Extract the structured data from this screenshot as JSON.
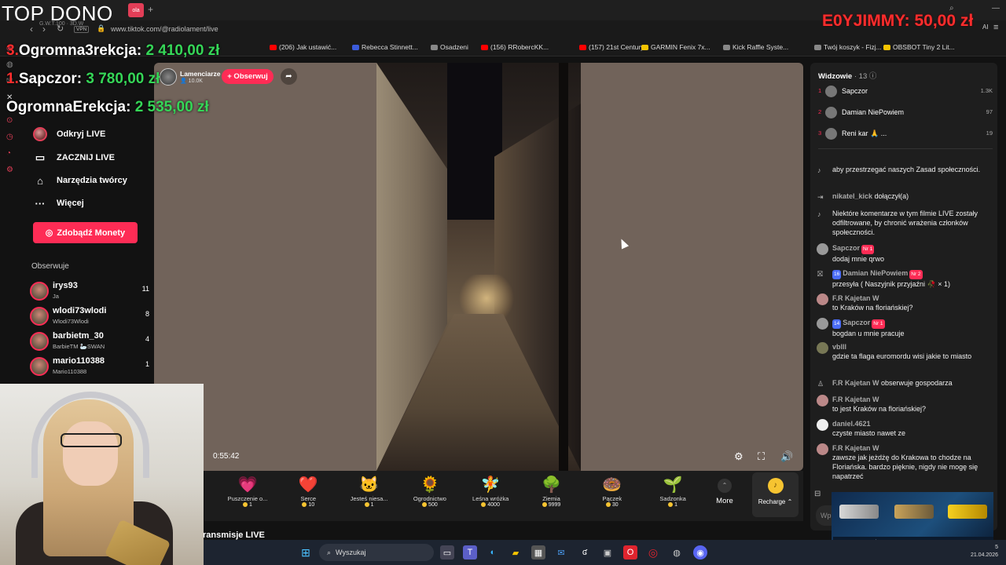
{
  "browser": {
    "tab_label": "ola",
    "url": "www.tiktok.com/@radiolament/live",
    "vpn_label": "VPN",
    "address_left_text": "G.W.T.100 · 3D.W",
    "bookmarks": [
      {
        "label": "(206) Jak ustawić...",
        "color": "#ff0000"
      },
      {
        "label": "Rebecca Stinnett...",
        "color": "#3b5bdb"
      },
      {
        "label": "Osadzeni",
        "color": "#888888"
      },
      {
        "label": "(156) RRobercKK...",
        "color": "#ff0000"
      },
      {
        "label": "(157) 21st Century...",
        "color": "#ff0000"
      },
      {
        "label": "GARMIN Fenix 7x...",
        "color": "#f5c400"
      },
      {
        "label": "Kick Raffle Syste...",
        "color": "#888888"
      },
      {
        "label": "Twój koszyk - Fizj...",
        "color": "#888888"
      },
      {
        "label": "OBSBOT Tiny 2 Lit...",
        "color": "#f5c400"
      }
    ]
  },
  "overlay": {
    "top_dono": "TOP DONO",
    "ranks": [
      {
        "num": "3.",
        "name": "Ogromna3rekcja:",
        "amount": "2 410,00 zł"
      },
      {
        "num": "1.",
        "name": "Sapczor:",
        "amount": "3 780,00 zł"
      },
      {
        "num": "",
        "name": "OgromnaErekcja:",
        "amount": "2 535,00 zł"
      }
    ],
    "jimmy": "E0YJIMMY: 50,00 zł"
  },
  "nav": {
    "items": [
      {
        "label": "Odkryj LIVE",
        "icon": "avatar-icon"
      },
      {
        "label": "ZACZNIJ LIVE",
        "icon": "camera-icon"
      },
      {
        "label": "Narzędzia twórcy",
        "icon": "home-tools-icon"
      },
      {
        "label": "Więcej",
        "icon": "more-dots-icon"
      }
    ],
    "coins_button": "Zdobądź Monety",
    "following_title": "Obserwuje",
    "following": [
      {
        "name": "irys93",
        "sub": "Ja",
        "count": "11"
      },
      {
        "name": "wlodi73wlodi",
        "sub": "Wlodi73Wlodi",
        "count": "8"
      },
      {
        "name": "barbietm_30",
        "sub": "BarbieTM 🦢SWAN",
        "count": "4"
      },
      {
        "name": "mario110388",
        "sub": "Mario110388",
        "count": "1"
      }
    ]
  },
  "player": {
    "streamer_name": "Lamenciarze",
    "streamer_followers": "10.0K",
    "follow_button": "+ Obserwuj",
    "timer": "0:55:42",
    "below_text": "ransmisje LIVE"
  },
  "gifts": [
    {
      "name": "Puszczenie o...",
      "price": "1",
      "icon": "💗"
    },
    {
      "name": "Serce",
      "price": "10",
      "icon": "❤️"
    },
    {
      "name": "Jesteś niesa...",
      "price": "1",
      "icon": "🐱"
    },
    {
      "name": "Ogrodnictwo",
      "price": "500",
      "icon": "🌻"
    },
    {
      "name": "Leśna wróżka",
      "price": "4000",
      "icon": "🧚"
    },
    {
      "name": "Ziemia",
      "price": "9999",
      "icon": "🌳"
    },
    {
      "name": "Pączek",
      "price": "30",
      "icon": "🍩"
    },
    {
      "name": "Sadzonka",
      "price": "1",
      "icon": "🌱"
    }
  ],
  "gift_more": "More",
  "recharge": "Recharge",
  "chat": {
    "viewers_title": "Widzowie",
    "viewers_count": "13",
    "top_viewers": [
      {
        "rank": "1",
        "name": "Sapczor",
        "score": "1.3K"
      },
      {
        "rank": "2",
        "name": "Damian NiePowiem",
        "score": "97"
      },
      {
        "rank": "3",
        "name": "Reni kar 🙏 ...",
        "score": "19"
      }
    ],
    "messages": [
      {
        "user": "",
        "text": "aby przestrzegać naszych Zasad społeczności.",
        "type": "system"
      },
      {
        "user": "nikatel_kick",
        "text": "dołączył(a)",
        "type": "join"
      },
      {
        "user": "",
        "text": "Niektóre komentarze w tym filmie LIVE zostały odfiltrowane, by chronić wrażenia członków społeczności.",
        "type": "system"
      },
      {
        "user": "Sapczor",
        "badge": "Nr 1",
        "text": "dodaj mnie qrwo",
        "type": "chat"
      },
      {
        "user": "Damian NiePowiem",
        "level": "16",
        "badge": "Nr 2",
        "text": "przesyła ( Naszyjnik przyjaźni 🥀 × 1)",
        "type": "gift"
      },
      {
        "user": "F.R Kajetan W",
        "text": "to Kraków na floriańskiej?",
        "type": "chat"
      },
      {
        "user": "Sapczor",
        "level": "14",
        "badge": "Nr 1",
        "text": "bogdan u mnie pracuje",
        "type": "chat"
      },
      {
        "user": "vblll",
        "text": "gdzie ta flaga euromordu wisi jakie to miasto",
        "type": "chat"
      },
      {
        "user": "F.R Kajetan W",
        "text": "obserwuje gospodarza",
        "type": "follow"
      },
      {
        "user": "F.R Kajetan W",
        "text": "to jest Kraków na floriańskiej?",
        "type": "chat"
      },
      {
        "user": "daniel.4621",
        "text": "czyste miasto nawet ze",
        "type": "chat"
      },
      {
        "user": "F.R Kajetan W",
        "text": "zawsze jak jeżdżę do Krakowa to chodze na Floriańska. bardzo pięknie, nigdy nie mogę się napatrzeć",
        "type": "chat"
      }
    ],
    "ad_text": "FREE $0.50 + 10% WITH CODE NIKATEL",
    "input_placeholder": "Wpis"
  },
  "taskbar": {
    "search_label": "Wyszukaj",
    "time": "5",
    "date": "21.04.2026"
  },
  "colors": {
    "accent": "#fe2c55",
    "overlay_red": "#ff2d2d",
    "overlay_green": "#35d657",
    "coin": "#f6c431"
  }
}
